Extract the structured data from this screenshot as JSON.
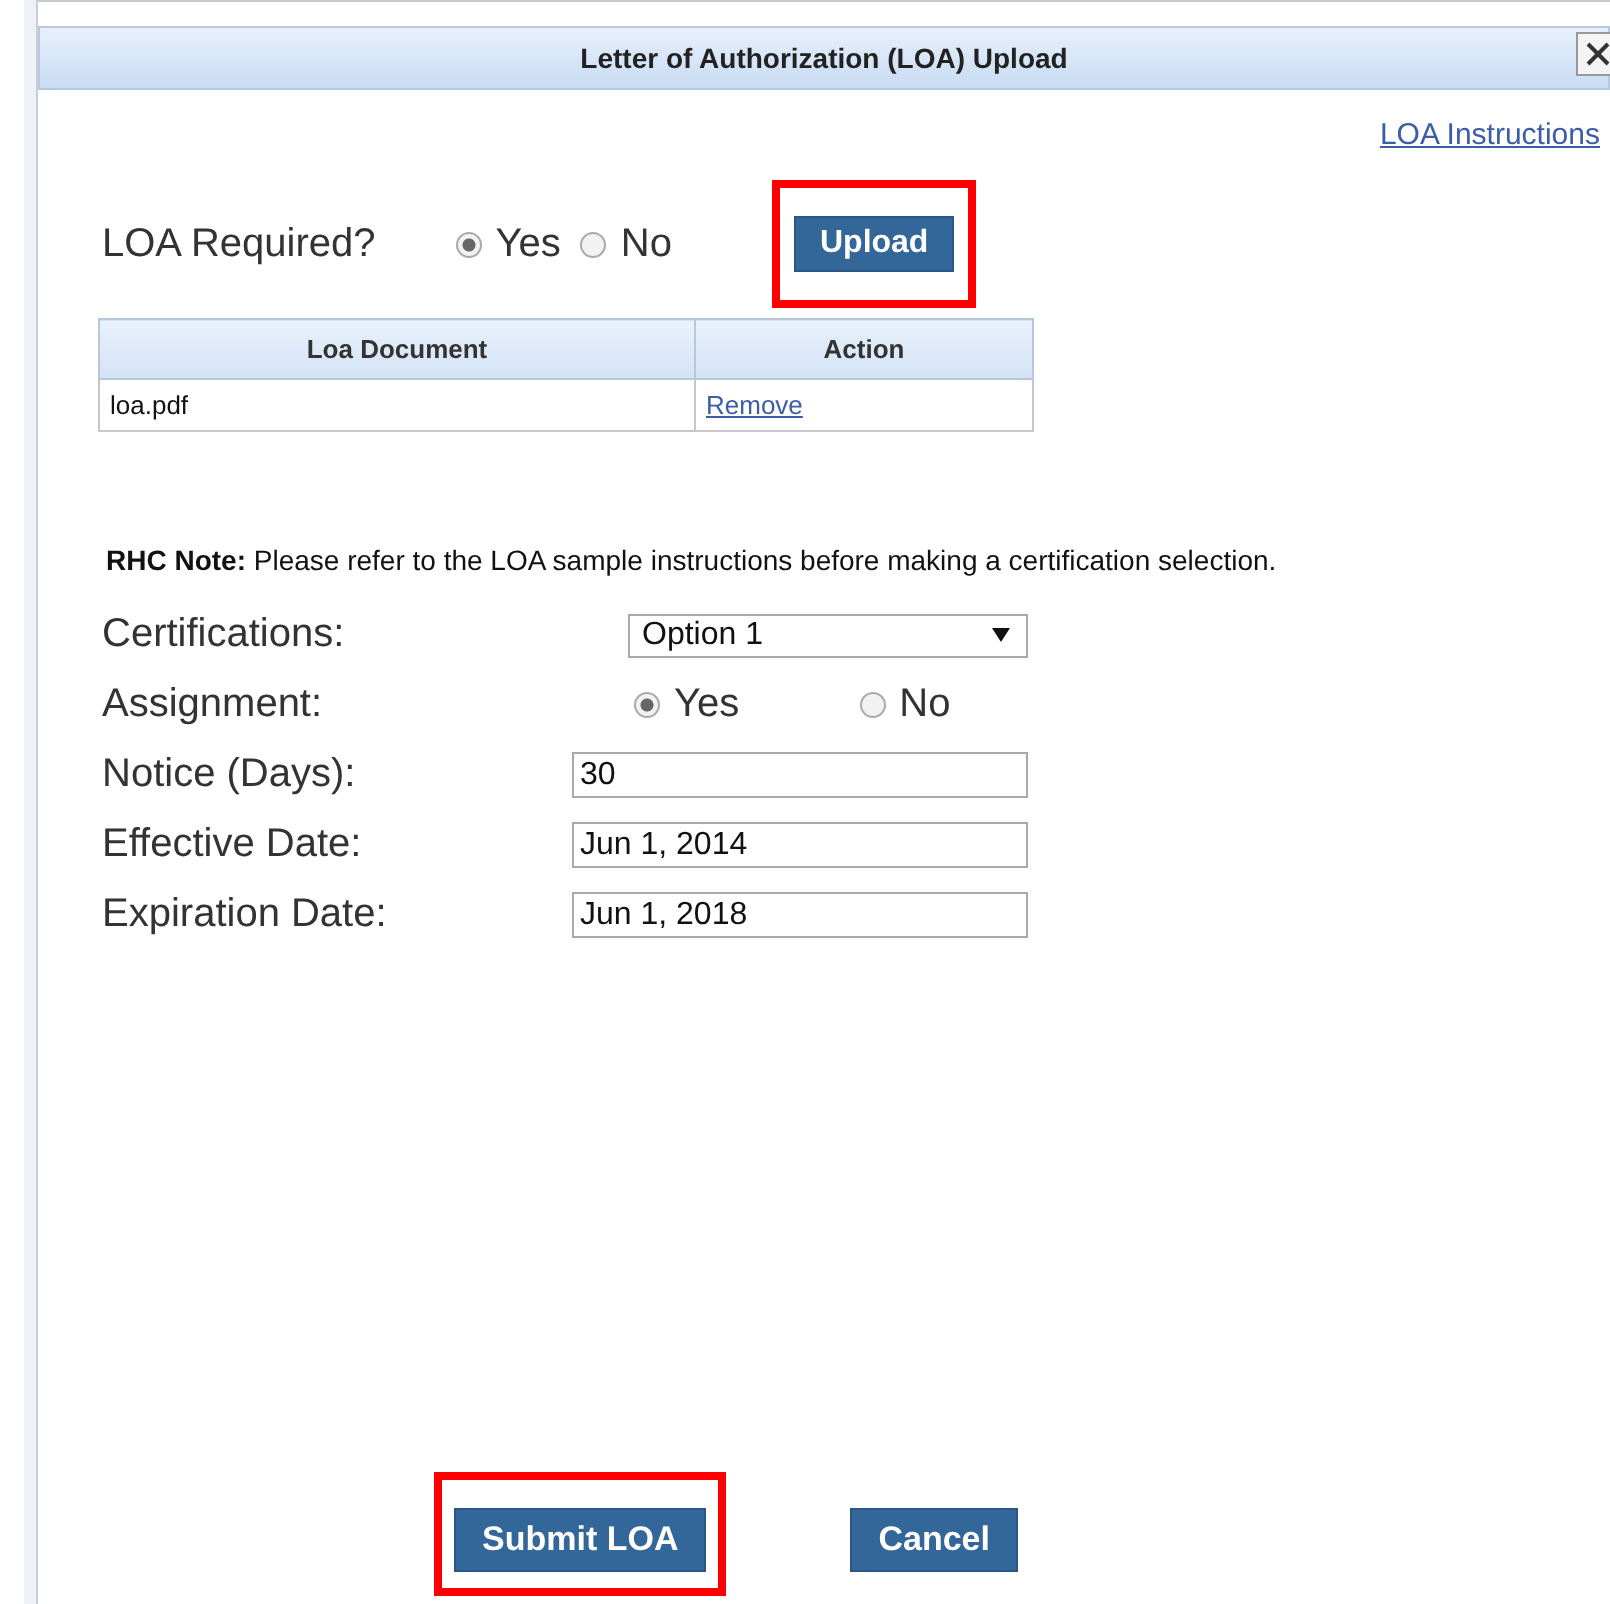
{
  "dialog": {
    "title": "Letter of Authorization (LOA) Upload",
    "instructions_link": "LOA Instructions",
    "loa_required": {
      "label": "LOA Required?",
      "options": [
        {
          "label": "Yes",
          "selected": true
        },
        {
          "label": "No",
          "selected": false
        }
      ]
    },
    "upload_button": {
      "label": "Upload",
      "highlighted": true
    },
    "table": {
      "columns": [
        "Loa Document",
        "Action"
      ],
      "rows": [
        {
          "document": "loa.pdf",
          "action": "Remove"
        }
      ]
    },
    "note": "**RHC Note:** Please refer to the LOA sample instructions before making a certification selection.",
    "fields": [
      {
        "kind": "select",
        "label": "Certifications:",
        "value": "Option 1"
      },
      {
        "kind": "radio",
        "label": "Assignment:",
        "options": [
          {
            "label": "Yes",
            "selected": true
          },
          {
            "label": "No",
            "selected": false
          }
        ]
      },
      {
        "kind": "text",
        "label": "Notice (Days):",
        "value": "30"
      },
      {
        "kind": "text",
        "label": "Effective Date:",
        "value": "Jun 1, 2014"
      },
      {
        "kind": "text",
        "label": "Expiration Date:",
        "value": "Jun 1, 2018"
      }
    ],
    "buttons": [
      {
        "label": "Submit LOA",
        "highlighted": true
      },
      {
        "label": "Cancel",
        "highlighted": false
      }
    ]
  }
}
